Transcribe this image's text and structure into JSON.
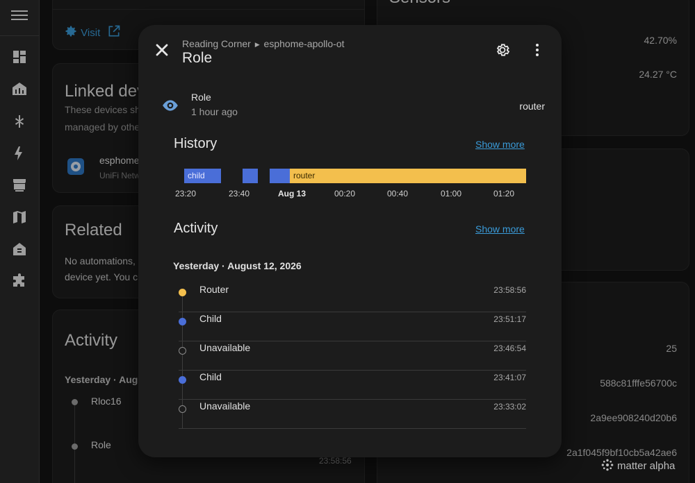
{
  "background": {
    "top_card": {
      "visit_label": "Visit"
    },
    "linked": {
      "title": "Linked devices",
      "desc_line1": "These devices sh",
      "desc_line2": "managed by othe",
      "device_name": "esphome",
      "device_sub": "UniFi Netw"
    },
    "related": {
      "title": "Related",
      "line1": "No automations,",
      "line2": "device yet. You c"
    },
    "activity": {
      "title": "Activity",
      "date": "Yesterday · Augu",
      "item1": "Rloc16",
      "item2": "Role",
      "time2": "23:58:56"
    },
    "sensors": {
      "title": "Sensors",
      "val1": "42.70%",
      "val2": "24.27 °C"
    },
    "right_values": {
      "v1": "25",
      "v2": "588c81fffe56700c",
      "v3": "2a9ee908240d20b6",
      "v4": "2a1f045f9bf10cb5a42ae6"
    }
  },
  "dialog": {
    "breadcrumb_area": "Reading Corner",
    "breadcrumb_device": "esphome-apollo-ot",
    "title": "Role",
    "state": {
      "name": "Role",
      "last_changed": "1 hour ago",
      "value": "router"
    },
    "history": {
      "title": "History",
      "show_more": "Show more",
      "segments": [
        {
          "label": "child",
          "state": "child"
        },
        {
          "label": "",
          "state": "child"
        },
        {
          "label": "",
          "state": "child"
        },
        {
          "label": "router",
          "state": "router"
        }
      ],
      "ticks": [
        "23:20",
        "23:40",
        "Aug 13",
        "00:20",
        "00:40",
        "01:00",
        "01:20"
      ]
    },
    "activity": {
      "title": "Activity",
      "show_more": "Show more",
      "date": "Yesterday · August 12, 2026",
      "items": [
        {
          "label": "Router",
          "time": "23:58:56",
          "dot": "router"
        },
        {
          "label": "Child",
          "time": "23:51:17",
          "dot": "child"
        },
        {
          "label": "Unavailable",
          "time": "23:46:54",
          "dot": "unavailable"
        },
        {
          "label": "Child",
          "time": "23:41:07",
          "dot": "child"
        },
        {
          "label": "Unavailable",
          "time": "23:33:02",
          "dot": "unavailable"
        }
      ]
    }
  },
  "watermark": "matter alpha",
  "colors": {
    "child": "#4a6ed8",
    "router": "#f3bf4d",
    "accent": "#3a9bd9"
  }
}
